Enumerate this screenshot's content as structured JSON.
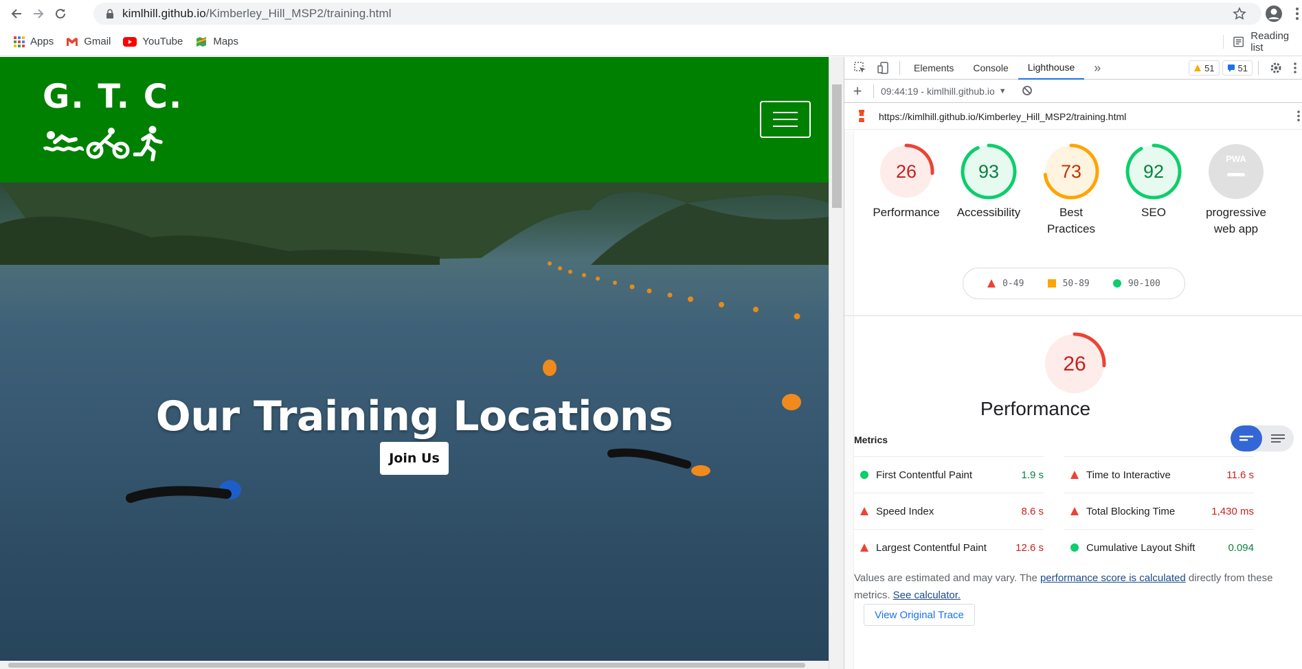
{
  "browser": {
    "url_host": "kimlhill.github.io",
    "url_path": "/Kimberley_Hill_MSP2/training.html",
    "bookmarks": [
      "Apps",
      "Gmail",
      "YouTube",
      "Maps"
    ],
    "reading_list": "Reading list"
  },
  "site": {
    "brand": "G. T. C.",
    "hero_title": "Our Training Locations",
    "join_button": "Join Us",
    "header_color": "#008000"
  },
  "devtools": {
    "tabs": [
      "Elements",
      "Console",
      "Lighthouse"
    ],
    "warnings_count": "51",
    "messages_count": "51",
    "report_selector": "09:44:19 - kimlhill.github.io",
    "report_url": "https://kimlhill.github.io/Kimberley_Hill_MSP2/training.html",
    "gauges": [
      {
        "score": "26",
        "label": "Performance",
        "value": 0.26,
        "status": "fail"
      },
      {
        "score": "93",
        "label": "Accessibility",
        "value": 0.93,
        "status": "pass"
      },
      {
        "score": "73",
        "label_line1": "Best",
        "label_line2": "Practices",
        "value": 0.73,
        "status": "average"
      },
      {
        "score": "92",
        "label": "SEO",
        "value": 0.92,
        "status": "pass"
      },
      {
        "score": "PWA",
        "label_line1": "progressive",
        "label_line2": "web app",
        "status": "na"
      }
    ],
    "legend": [
      "0-49",
      "50-89",
      "90-100"
    ],
    "performance": {
      "score": "26",
      "title": "Performance",
      "value": 0.26
    },
    "metrics_heading": "Metrics",
    "metrics": [
      {
        "name": "First Contentful Paint",
        "value": "1.9 s",
        "status": "pass"
      },
      {
        "name": "Time to Interactive",
        "value": "11.6 s",
        "status": "fail"
      },
      {
        "name": "Speed Index",
        "value": "8.6 s",
        "status": "fail"
      },
      {
        "name": "Total Blocking Time",
        "value": "1,430 ms",
        "status": "fail"
      },
      {
        "name": "Largest Contentful Paint",
        "value": "12.6 s",
        "status": "fail"
      },
      {
        "name": "Cumulative Layout Shift",
        "value": "0.094",
        "status": "pass"
      }
    ],
    "note_prefix": "Values are estimated and may vary. The ",
    "note_link1": "performance score is calculated",
    "note_mid": " directly from these metrics. ",
    "note_link2": "See calculator.",
    "trace_button": "View Original Trace",
    "colors": {
      "fail": "#eb4335",
      "average": "#ffa400",
      "pass": "#0cce6b",
      "na": "#c4c4c4"
    }
  }
}
